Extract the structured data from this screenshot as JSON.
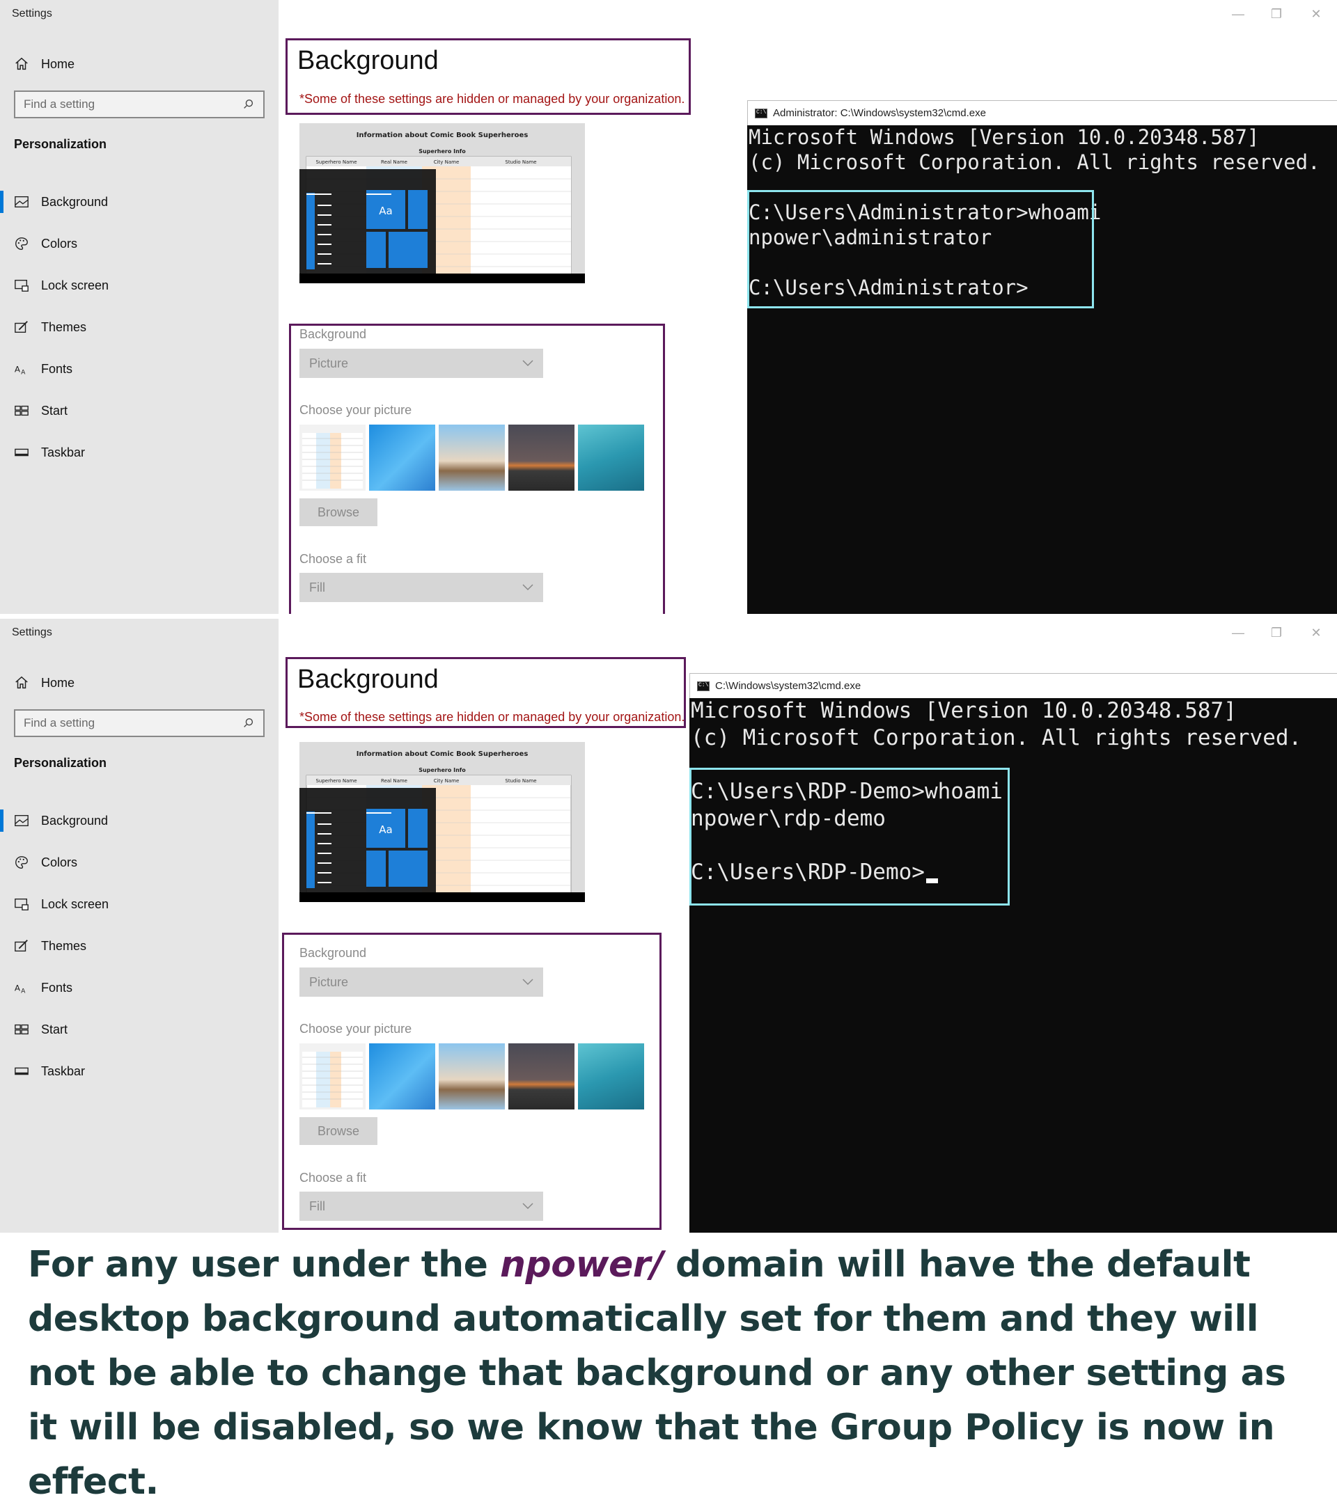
{
  "settings_app": {
    "title": "Settings",
    "home_label": "Home",
    "search_placeholder": "Find a setting",
    "section_title": "Personalization",
    "nav_items": [
      "Background",
      "Colors",
      "Lock screen",
      "Themes",
      "Fonts",
      "Start",
      "Taskbar"
    ],
    "active_nav": "Background"
  },
  "background_page": {
    "title": "Background",
    "managed_notice": "*Some of these settings are hidden or managed by your organization.",
    "background_label": "Background",
    "background_value": "Picture",
    "choose_picture_label": "Choose your picture",
    "browse_label": "Browse",
    "choose_fit_label": "Choose a fit",
    "fit_value": "Fill",
    "preview_tile_text": "Aa",
    "preview_doc_title": "Information about Comic Book Superheroes",
    "preview_doc_subtitle": "Superhero Info",
    "preview_columns": [
      "Superhero Name",
      "Real Name",
      "City Name",
      "Studio Name"
    ]
  },
  "cmd_window_1": {
    "title": "Administrator: C:\\Windows\\system32\\cmd.exe",
    "lines": [
      "Microsoft Windows [Version 10.0.20348.587]",
      "(c) Microsoft Corporation. All rights reserved.",
      "C:\\Users\\Administrator>whoami",
      "npower\\administrator",
      "C:\\Users\\Administrator>"
    ]
  },
  "cmd_window_2": {
    "title": "C:\\Windows\\system32\\cmd.exe",
    "lines": [
      "Microsoft Windows [Version 10.0.20348.587]",
      "(c) Microsoft Corporation. All rights reserved.",
      "C:\\Users\\RDP-Demo>whoami",
      "npower\\rdp-demo",
      "C:\\Users\\RDP-Demo>"
    ]
  },
  "caption": {
    "part1": "For any user under the ",
    "emphasis": "npower/",
    "part2": " domain will have the default desktop background automatically set for them and they will not be able to change that background or any other setting as it will be disabled, so we know that the Group Policy is now in effect."
  },
  "colors": {
    "accent": "#0078d7",
    "highlight_box": "#5b1a5b",
    "cmd_highlight": "#8ee5ee",
    "managed_text": "#a31515",
    "caption_text": "#1d3b3c"
  }
}
